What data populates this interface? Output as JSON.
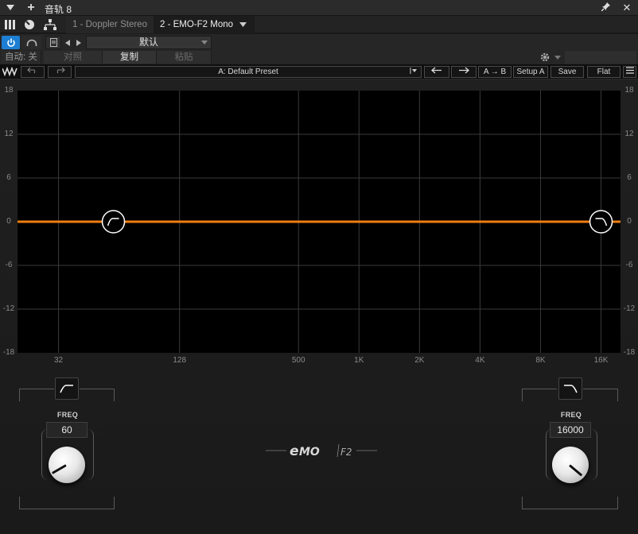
{
  "titlebar": {
    "title": "音轨 8"
  },
  "tabs": [
    {
      "label": "1 - Doppler Stereo"
    },
    {
      "label": "2 - EMO-F2 Mono"
    }
  ],
  "preset": {
    "name": "默认",
    "auto_label": "自动: 关",
    "compare_label": "对照",
    "copy_label": "复制",
    "paste_label": "粘贴"
  },
  "waves_toolbar": {
    "preset_label": "A: Default Preset",
    "ab_label": "A → B",
    "setup_label": "Setup A",
    "save_label": "Save",
    "flat_label": "Flat"
  },
  "chart_data": {
    "type": "line",
    "y_ticks": [
      "18",
      "12",
      "6",
      "0",
      "-6",
      "-12",
      "-18"
    ],
    "ylim": [
      -18,
      18
    ],
    "x_ticks": [
      "32",
      "128",
      "500",
      "1K",
      "2K",
      "4K",
      "8K",
      "16K"
    ],
    "x_tick_values": [
      32,
      128,
      500,
      1000,
      2000,
      4000,
      8000,
      16000
    ],
    "xlim": [
      20,
      20000
    ],
    "x_scale": "log",
    "grid": true,
    "series": [
      {
        "x": [
          20,
          60,
          16000,
          20000
        ],
        "y": [
          0,
          0,
          0,
          0
        ],
        "color": "#f07d12"
      }
    ],
    "handles": [
      {
        "x": 60,
        "y": 0,
        "icon": "high-pass-icon"
      },
      {
        "x": 16000,
        "y": 0,
        "icon": "low-pass-icon"
      }
    ]
  },
  "controls": {
    "hpf": {
      "freq_label": "FREQ",
      "value": "60"
    },
    "lpf": {
      "freq_label": "FREQ",
      "value": "16000"
    }
  },
  "colors": {
    "accent": "#f07d12",
    "power": "#1d7fd4"
  }
}
